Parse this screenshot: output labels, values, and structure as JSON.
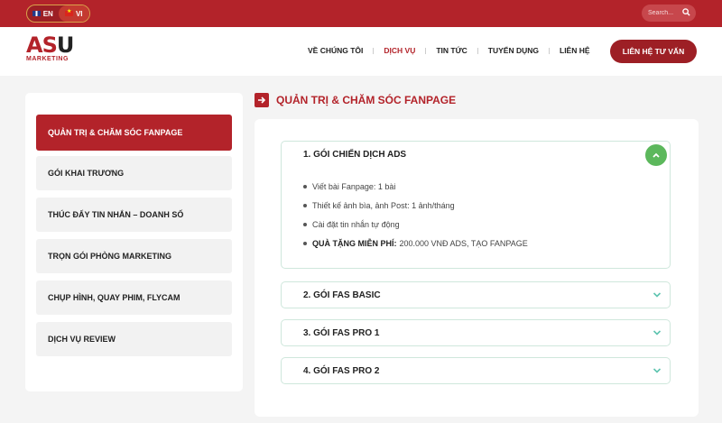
{
  "topbar": {
    "lang_en": "EN",
    "lang_vi": "VI",
    "search_placeholder": "Search..."
  },
  "logo": {
    "brand_a": "AS",
    "brand_b": "U",
    "sub": "MARKETING"
  },
  "nav": {
    "items": [
      "VỀ CHÚNG TÔI",
      "DỊCH VỤ",
      "TIN TỨC",
      "TUYỂN DỤNG",
      "LIÊN HỆ"
    ],
    "active_index": 1,
    "cta": "LIÊN HỆ TƯ VẤN"
  },
  "sidebar": {
    "items": [
      "QUẢN TRỊ & CHĂM SÓC FANPAGE",
      "GÓI KHAI TRƯƠNG",
      "THÚC ĐẨY TIN NHẮN – DOANH SỐ",
      "TRỌN GÓI PHÒNG MARKETING",
      "CHỤP HÌNH, QUAY PHIM, FLYCAM",
      "DỊCH VỤ REVIEW"
    ],
    "active_index": 0
  },
  "main": {
    "title": "QUẢN TRỊ & CHĂM SÓC FANPAGE",
    "accordions": [
      {
        "title": "1. GÓI CHIẾN DỊCH ADS",
        "expanded": true,
        "bullets": [
          "Viết bài Fanpage: 1 bài",
          "Thiết kế ảnh bìa, ảnh Post: 1 ảnh/tháng",
          "Cài đặt tin nhắn tự động"
        ],
        "gift_label": "QUÀ TẶNG MIỄN PHÍ:",
        "gift_value": "200.000 VNĐ ADS, TẠO FANPAGE"
      },
      {
        "title": "2. GÓI FAS BASIC",
        "expanded": false
      },
      {
        "title": "3. GÓI FAS PRO 1",
        "expanded": false
      },
      {
        "title": "4. GÓI FAS PRO 2",
        "expanded": false
      }
    ]
  },
  "colors": {
    "brand_red": "#b3232a",
    "accent_green": "#5cb85c",
    "chevron_teal": "#5ec4b0"
  }
}
